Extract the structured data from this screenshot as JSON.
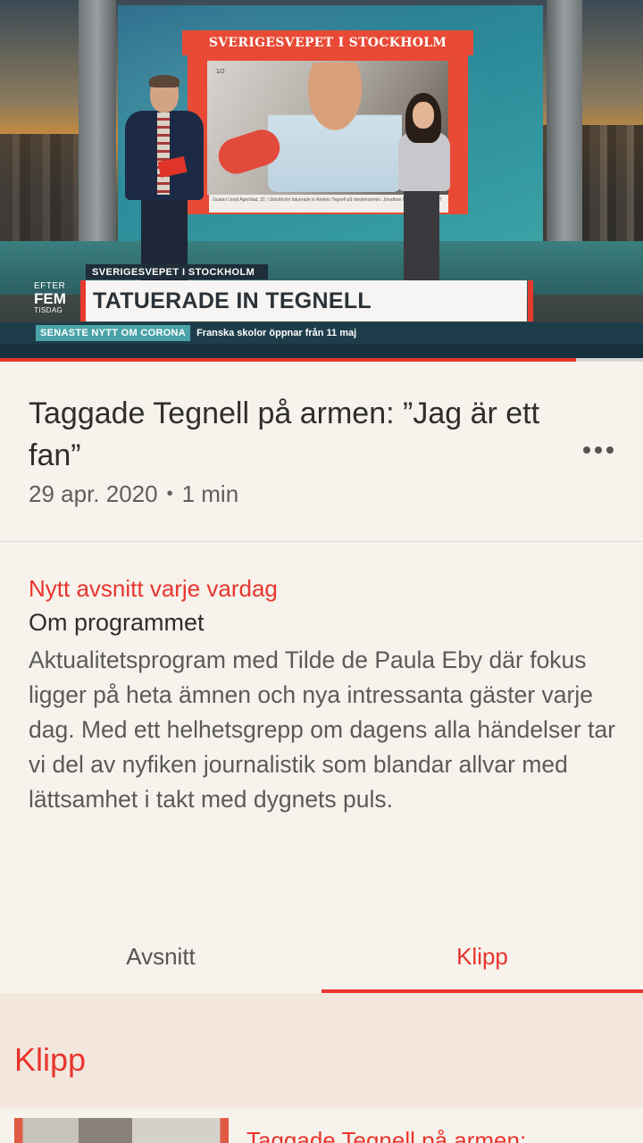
{
  "player": {
    "screen_banner": "SVERIGESVEPET I STOCKHOLM",
    "screen_counter": "1/2",
    "screen_caption": "Gustav Lloyd Agerblad, 32, i Stockholm tatuerade in Anders Tegnell på vänsterarmen. Jonathan Nackstrand/AFP/TT",
    "lower_third_small": "SVERIGESVEPET I STOCKHOLM",
    "lower_third_main": "TATUERADE IN TEGNELL",
    "logo_line1": "EFTER",
    "logo_line2": "FEM",
    "logo_line3": "TISDAG",
    "ticker_tag": "SENASTE NYTT OM CORONA",
    "ticker_text": "Franska skolor öppnar från 11 maj",
    "progress_fraction": 0.896
  },
  "episode": {
    "title": "Taggade Tegnell på armen: ”Jag är ett fan”",
    "date": "29 apr. 2020",
    "separator": "•",
    "duration": "1 min"
  },
  "program": {
    "schedule": "Nytt avsnitt varje vardag",
    "about_label": "Om programmet",
    "description": "Aktualitetsprogram med Tilde de Paula Eby där fokus ligger på heta ämnen och nya intressanta gäster varje dag. Med ett helhetsgrepp om dagens alla händelser tar vi del av nyfiken journalistik som blandar allvar med lättsamhet i takt med dygnets puls."
  },
  "tabs": {
    "episodes": "Avsnitt",
    "clips": "Klipp",
    "active": "clips"
  },
  "clips_section": {
    "title": "Klipp",
    "first_clip_title": "Taggade Tegnell på armen:"
  },
  "colors": {
    "accent": "#e8352e",
    "background": "#f7f2ec",
    "section_background": "#f3e6dd"
  },
  "icons": {
    "more": "more-horizontal-icon"
  }
}
